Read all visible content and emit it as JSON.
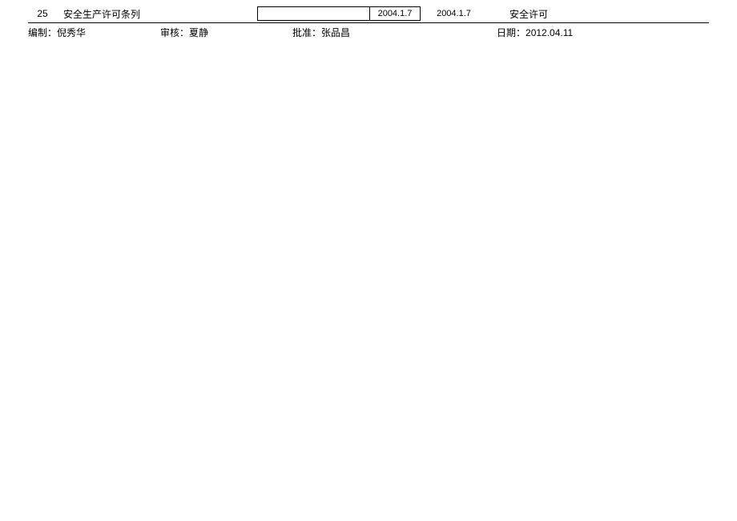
{
  "table": {
    "row": {
      "num": "25",
      "title": "安全生产许可条列",
      "boxed": "",
      "date1": "2004.1.7",
      "date2": "2004.1.7",
      "category": "安全许可"
    }
  },
  "footer": {
    "compiler_label": "编制：",
    "compiler_value": "倪秀华",
    "reviewer_label": "审核：",
    "reviewer_value": "夏静",
    "approver_label": "批准：",
    "approver_value": "张品昌",
    "date_label": "日期：",
    "date_value": "2012.04.11"
  }
}
